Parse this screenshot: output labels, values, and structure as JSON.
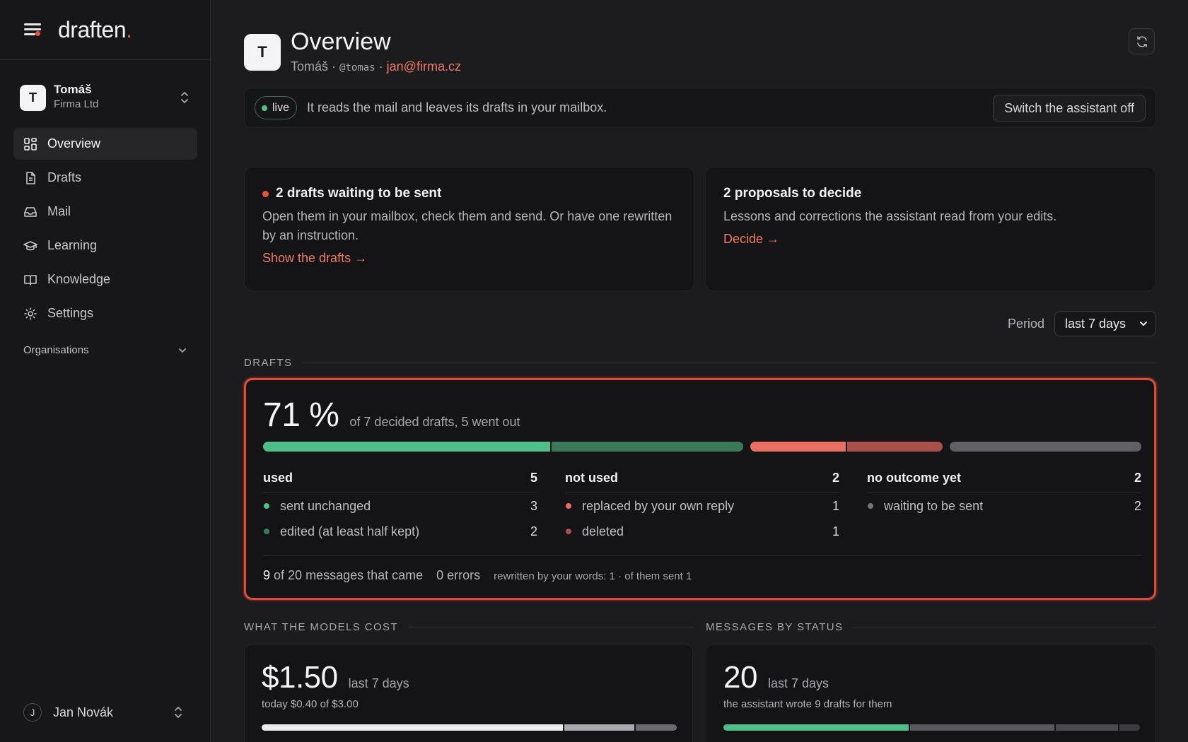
{
  "brand": {
    "name": "draften",
    "dot": "."
  },
  "account": {
    "initial": "T",
    "name": "Tomáš",
    "org": "Firma Ltd"
  },
  "nav": [
    {
      "label": "Overview",
      "icon": "grid-icon",
      "active": true
    },
    {
      "label": "Drafts",
      "icon": "file-icon"
    },
    {
      "label": "Mail",
      "icon": "inbox-icon"
    },
    {
      "label": "Learning",
      "icon": "graduation-cap-icon"
    },
    {
      "label": "Knowledge",
      "icon": "book-icon"
    },
    {
      "label": "Settings",
      "icon": "gear-icon"
    }
  ],
  "nav_section": {
    "label": "Organisations"
  },
  "user": {
    "initial": "J",
    "name": "Jan Novák"
  },
  "header": {
    "initial": "T",
    "title": "Overview",
    "name": "Tomáš",
    "separator": "·",
    "handle": "@tomas",
    "email": "jan@firma.cz"
  },
  "status": {
    "badge": "live",
    "text": "It reads the mail and leaves its drafts in your mailbox.",
    "button": "Switch the assistant off"
  },
  "tasks": {
    "drafts": {
      "title": "2 drafts waiting to be sent",
      "body": "Open them in your mailbox, check them and send. Or have one rewritten by an instruction.",
      "link": "Show the drafts →"
    },
    "proposals": {
      "title": "2 proposals to decide",
      "body": "Lessons and corrections the assistant read from your edits.",
      "link": "Decide →"
    }
  },
  "period": {
    "label": "Period",
    "selected": "last 7 days"
  },
  "drafts_section": {
    "heading": "DRAFTS",
    "big": "71 %",
    "note": "of 7 decided drafts, 5 went out",
    "bar": [
      {
        "key": "sent_unchanged",
        "value": 3,
        "color": "#4fbf87"
      },
      {
        "key": "edited",
        "value": 2,
        "color": "#3a7a58"
      },
      {
        "key": "replaced",
        "value": 1,
        "color": "#ea6f62"
      },
      {
        "key": "deleted",
        "value": 1,
        "color": "#a9504a"
      },
      {
        "key": "waiting",
        "value": 2,
        "color": "#606066"
      }
    ],
    "columns": [
      {
        "label": "used",
        "total": "5",
        "rows": [
          {
            "label": "sent unchanged",
            "value": "3",
            "color": "#4fbf87"
          },
          {
            "label": "edited (at least half kept)",
            "value": "2",
            "color": "#3a7a58"
          }
        ]
      },
      {
        "label": "not used",
        "total": "2",
        "rows": [
          {
            "label": "replaced by your own reply",
            "value": "1",
            "color": "#ea6f62"
          },
          {
            "label": "deleted",
            "value": "1",
            "color": "#a9504a"
          }
        ]
      },
      {
        "label": "no outcome yet",
        "total": "2",
        "rows": [
          {
            "label": "waiting to be sent",
            "value": "2",
            "color": "#75757b"
          }
        ]
      }
    ],
    "footer": {
      "count": "9",
      "count_suffix": "of 20 messages that came",
      "errors": "0 errors",
      "rewritten": "rewritten by your words: 1 · of them sent 1"
    }
  },
  "cost_section": {
    "heading": "WHAT THE MODELS COST",
    "big": "$1.50",
    "note": "last 7 days",
    "caption": "today $0.40 of $3.00",
    "bar": [
      {
        "value": 0.73,
        "color": "#ececee"
      },
      {
        "value": 0.17,
        "color": "#a8a8ac"
      },
      {
        "value": 0.1,
        "color": "#6a6a70"
      }
    ]
  },
  "messages_section": {
    "heading": "MESSAGES BY STATUS",
    "big": "20",
    "note": "last 7 days",
    "caption": "the assistant wrote 9 drafts for them",
    "bar": [
      {
        "value": 0.45,
        "color": "#4fbf87"
      },
      {
        "value": 0.35,
        "color": "#58585e"
      },
      {
        "value": 0.15,
        "color": "#4a4a50"
      },
      {
        "value": 0.05,
        "color": "#3a3a3f"
      }
    ]
  }
}
